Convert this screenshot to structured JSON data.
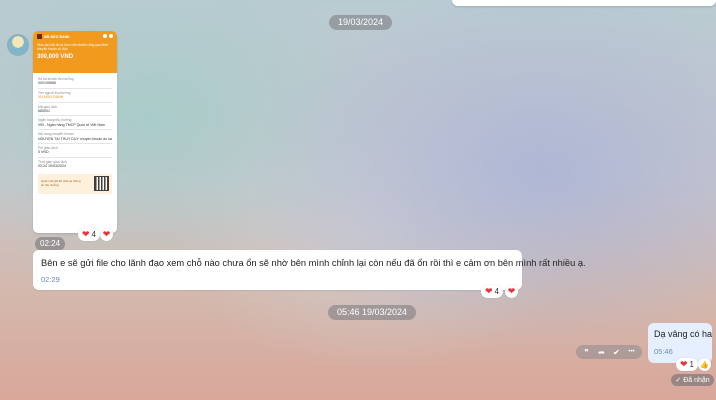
{
  "dates": {
    "first": "19/03/2024",
    "second": "05:46 19/03/2024"
  },
  "receipt": {
    "bank_name": "MB NEO BANK",
    "description": "Giao dịch đã được thực hiện thành công qua kênh chuyển khoản số Bản",
    "amount": "300,000 VND",
    "fields": [
      {
        "label": "Số tài khoản thụ hưởng",
        "value": "000109686"
      },
      {
        "label": "Tên người thụ hưởng",
        "value": "VU NGO DANH",
        "highlight": true
      },
      {
        "label": "Mã giao dịch",
        "value": "685001"
      },
      {
        "label": "Ngân hàng thụ hưởng",
        "value": "VIB - Ngân hàng TMCP Quốc tế Việt Nam"
      },
      {
        "label": "Nội dung chuyển khoản",
        "value": "NGUYEN TAI THUY DUY chuyen khoan do sa"
      },
      {
        "label": "Phí giao dịch",
        "value": "0 VND"
      },
      {
        "label": "Thời gian giao dịch",
        "value": "02:24 19/03/2024"
      }
    ],
    "qr_note": "Quét mã QR để chia sẻ thông tin thụ hưởng"
  },
  "messages": {
    "image_time": "02:24",
    "image_reaction_count": "4",
    "text": "Bên e sẽ gửi file cho lãnh đạo xem chỗ nào chưa ổn sẽ nhờ bên mình chỉnh lại còn nếu đã ổn rồi thì e cảm ơn bên mình rất nhiều ạ.",
    "text_time": "02:29",
    "text_reaction_count": "4",
    "reply": "Dạ vâng có ha",
    "reply_time": "05:46",
    "reply_reaction_count": "1",
    "received_label": "Đã nhận"
  },
  "icons": {
    "heart": "❤",
    "quote": "❞",
    "forward": "➦",
    "check": "✔",
    "more": "•••",
    "like": "👍",
    "double_check": "✓"
  },
  "colors": {
    "receipt_header": "#f29a1e",
    "heart": "#e8343f",
    "reply_bubble": "#e5efff",
    "timestamp": "#6d8cb0"
  }
}
